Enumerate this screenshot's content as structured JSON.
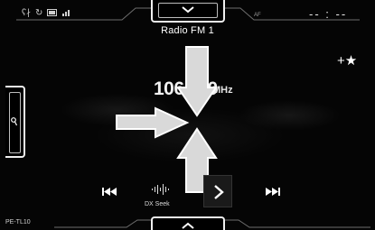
{
  "header": {
    "station_title": "Radio FM 1",
    "af_label": "AF",
    "clock": "-- : --"
  },
  "main": {
    "frequency_prefix": "106",
    "frequency_suffix": "0",
    "frequency_unit": "MHz"
  },
  "controls": {
    "favorite_symbol": "+★",
    "dx_seek_label": "DX Seek"
  },
  "footer": {
    "device_label": "PE-TL10"
  },
  "icons": {
    "top_tab": "chevron-down-icon",
    "bottom_tab": "chevron-up-icon",
    "left_handle": "search-icon",
    "prev": "skip-previous-icon",
    "next": "skip-next-icon",
    "dx": "waveform-icon",
    "next_station": "chevron-right-icon"
  },
  "colors": {
    "background": "#000000",
    "text": "#ffffff",
    "arrow_fill": "#d9d9d9",
    "arrow_stroke": "#ffffff"
  }
}
